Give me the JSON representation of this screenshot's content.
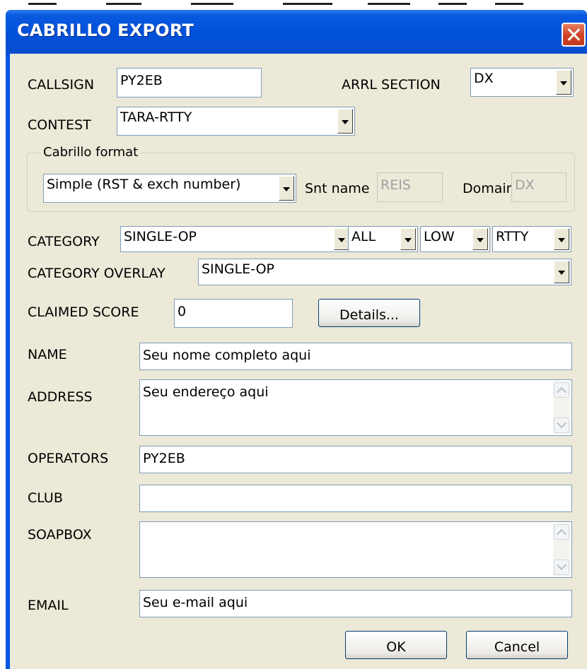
{
  "window": {
    "title": "CABRILLO EXPORT"
  },
  "callsign": {
    "label": "CALLSIGN",
    "value": "PY2EB"
  },
  "arrl_section": {
    "label": "ARRL SECTION",
    "value": "DX"
  },
  "contest": {
    "label": "CONTEST",
    "value": "TARA-RTTY"
  },
  "cabrillo_format": {
    "legend": "Cabrillo format",
    "format_value": "Simple (RST & exch number)",
    "snt_name_label": "Snt name",
    "snt_name_value": "REIS",
    "domain_label": "Domain",
    "domain_value": "DX"
  },
  "category": {
    "label": "CATEGORY",
    "operator": "SINGLE-OP",
    "band": "ALL",
    "power": "LOW",
    "mode": "RTTY"
  },
  "category_overlay": {
    "label": "CATEGORY OVERLAY",
    "value": "SINGLE-OP"
  },
  "claimed_score": {
    "label": "CLAIMED SCORE",
    "value": "0",
    "details_button": "Details..."
  },
  "name": {
    "label": "NAME",
    "value": "Seu nome completo aqui"
  },
  "address": {
    "label": "ADDRESS",
    "value": "Seu endereço aqui"
  },
  "operators": {
    "label": "OPERATORS",
    "value": "PY2EB"
  },
  "club": {
    "label": "CLUB",
    "value": ""
  },
  "soapbox": {
    "label": "SOAPBOX",
    "value": ""
  },
  "email": {
    "label": "EMAIL",
    "value": "Seu e-mail aqui"
  },
  "buttons": {
    "ok": "OK",
    "cancel": "Cancel"
  },
  "colors": {
    "titlebar": "#0050d8",
    "client": "#ece9d8",
    "field_border": "#7f9db9",
    "close": "#d0452a"
  }
}
